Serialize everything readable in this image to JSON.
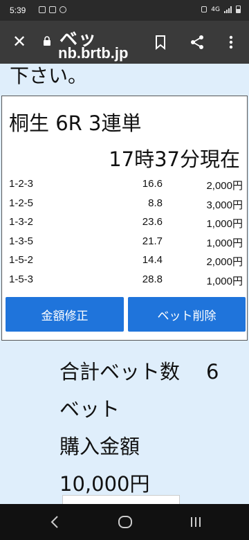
{
  "status_bar": {
    "time": "5:39",
    "network": "4G"
  },
  "app_bar": {
    "title": "ベッ",
    "url": "nb.brtb.jp",
    "icons": [
      "close-icon",
      "lock-icon",
      "bookmark-icon",
      "share-icon",
      "more-vert-icon"
    ]
  },
  "prev_text": "下さい。",
  "card": {
    "race": "桐生 6R 3連単",
    "as_of": "17時37分現在",
    "rows": [
      {
        "combo": "1-2-3",
        "odds": "16.6",
        "amount": "2,000円"
      },
      {
        "combo": "1-2-5",
        "odds": "8.8",
        "amount": "3,000円"
      },
      {
        "combo": "1-3-2",
        "odds": "23.6",
        "amount": "1,000円"
      },
      {
        "combo": "1-3-5",
        "odds": "21.7",
        "amount": "1,000円"
      },
      {
        "combo": "1-5-2",
        "odds": "14.4",
        "amount": "2,000円"
      },
      {
        "combo": "1-5-3",
        "odds": "28.8",
        "amount": "1,000円"
      }
    ],
    "fix_amount_label": "金額修正",
    "delete_bet_label": "ベット削除"
  },
  "summary": {
    "total_bets_label": "合計ベット数",
    "total_bets_value": "6",
    "total_bets_unit": "ベット",
    "purchase_label": "購入金額",
    "purchase_value": "10,000円"
  },
  "colors": {
    "accent": "#1f74db",
    "background": "#dfeefb",
    "app_bar": "#3a3a3a"
  }
}
